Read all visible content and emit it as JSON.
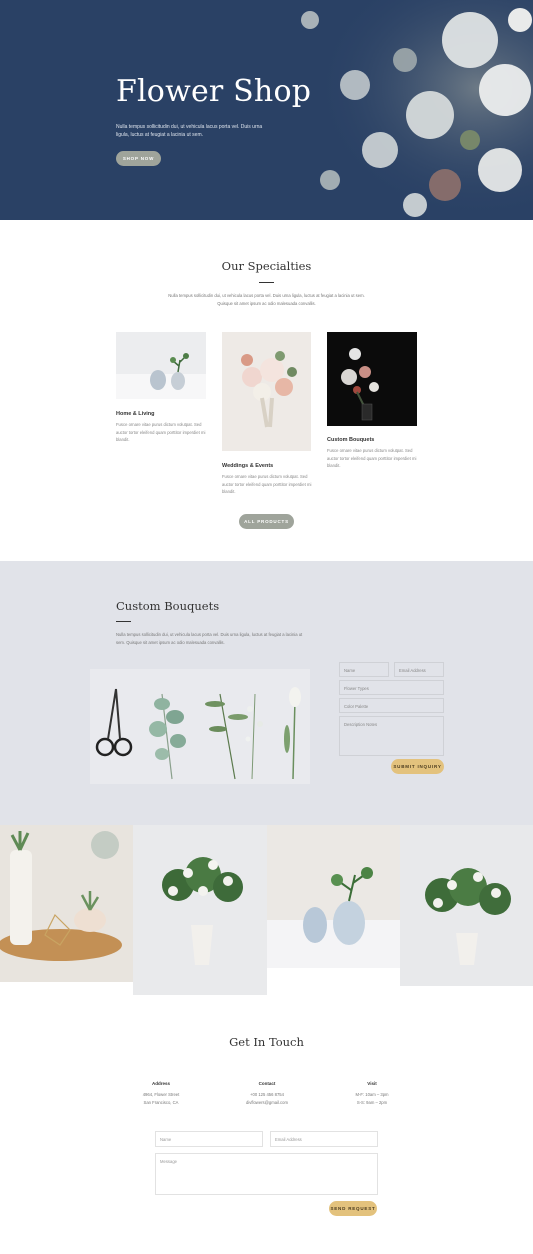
{
  "hero": {
    "title": "Flower Shop",
    "text": "Nulla tempus sollicitudin dui, ut vehicula lacus porta vel. Duis urna ligula, luctus at feugiat a lacinia ut sem.",
    "button": "Shop Now"
  },
  "specialties": {
    "title": "Our Specialties",
    "intro": "Nulla tempus sollicitudin dui, ut vehicula lacus porta vel. Duis urna ligula, luctus at feugiat a lacinia ut sem. Quisque sit amet ipsum ac odio malesuada convallis.",
    "cards": [
      {
        "title": "Home & Living",
        "text": "Fusce ornare vitae purus dictum volutpat. Sed auctor tortor eleifend quam porttitor imperdiet mi blandit."
      },
      {
        "title": "Weddings & Events",
        "text": "Fusce ornare vitae purus dictum volutpat. Sed auctor tortor eleifend quam porttitor imperdiet mi blandit."
      },
      {
        "title": "Custom Bouquets",
        "text": "Fusce ornare vitae purus dictum volutpat. Sed auctor tortor eleifend quam porttitor imperdiet mi blandit."
      }
    ],
    "button": "All Products"
  },
  "bouquets": {
    "title": "Custom Bouquets",
    "intro": "Nulla tempus sollicitudin dui, ut vehicula lacus porta vel. Duis urna ligula, luctus at feugiat a lacinia ut sem. Quisque sit amet ipsum ac odio malesuada convallis.",
    "form": {
      "name": "Name",
      "email": "Email Address",
      "flower_types": "Flower Types",
      "color_palette": "Color Palette",
      "description": "Description Notes",
      "submit": "Submit Inquiry"
    }
  },
  "contact": {
    "title": "Get In Touch",
    "address": {
      "label": "Address",
      "lines": [
        "4964, Flower Street",
        "San Francisco, CA"
      ]
    },
    "contact": {
      "label": "Contact",
      "lines": [
        "+00 125 456 8754",
        "divflowers@gmail.com"
      ]
    },
    "visit": {
      "label": "Visit",
      "lines": [
        "M-F: 10am – 3pm",
        "S-S: 9am – 2pm"
      ]
    },
    "form": {
      "name": "Name",
      "email": "Email Address",
      "message": "Message",
      "submit": "Send Request"
    }
  },
  "colors": {
    "hero_bg": "#2a4165",
    "sage_button": "#9fa49b",
    "gold_button": "#e3c27d",
    "section_gray": "#e1e3e9"
  }
}
